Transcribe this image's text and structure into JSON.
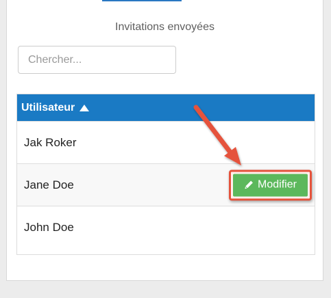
{
  "panel": {
    "title": "Invitations envoyées"
  },
  "search": {
    "placeholder": "Chercher...",
    "value": ""
  },
  "table": {
    "column_header": "Utilisateur",
    "sort_icon": "sort-ascending-icon",
    "rows": [
      {
        "name": "Jak Roker"
      },
      {
        "name": "Jane Doe",
        "action_label": "Modifier",
        "action_icon": "pencil-icon"
      },
      {
        "name": "John Doe"
      }
    ]
  },
  "colors": {
    "header_blue": "#1a7ac4",
    "tab_blue": "#2a78c2",
    "button_green": "#5cb85c",
    "annotation_red": "#e5533c"
  },
  "annotation": {
    "icon": "arrow-annotation-icon"
  }
}
